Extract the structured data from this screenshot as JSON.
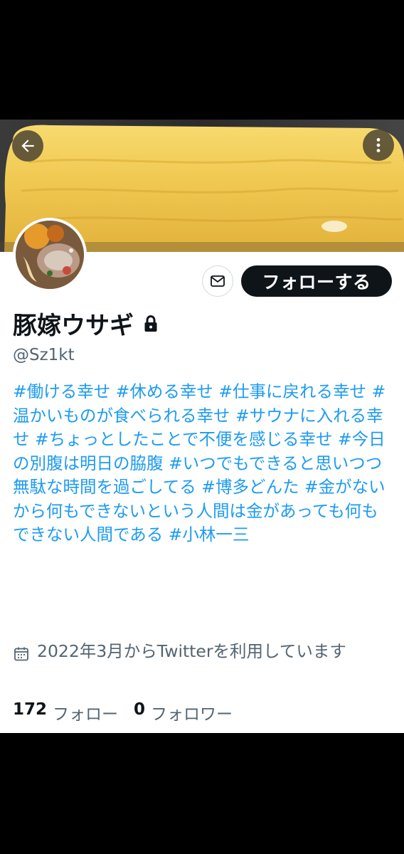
{
  "colors": {
    "accent": "#1d9bf0",
    "text_primary": "#0f1419",
    "text_secondary": "#536471",
    "follow_button_bg": "#0f1419",
    "banner_food": "#f2cc55"
  },
  "header": {
    "back_icon": "arrow-left-icon",
    "more_icon": "more-vertical-icon"
  },
  "actions": {
    "message_icon": "envelope-icon",
    "follow_label": "フォローする"
  },
  "profile": {
    "display_name": "豚嫁ウサギ",
    "protected_icon": "lock-icon",
    "handle": "@Sz1kt",
    "bio": "#働ける幸せ #休める幸せ #仕事に戻れる幸せ #温かいものが食べられる幸せ #サウナに入れる幸せ #ちょっとしたことで不便を感じる幸せ #今日の別腹は明日の脇腹 #いつでもできると思いつつ無駄な時間を過ごしてる #博多どんた #金がないから何もできないという人間は金があっても何もできない人間である #小林一三",
    "joined_icon": "calendar-icon",
    "joined": "2022年3月からTwitterを利用しています"
  },
  "stats": {
    "following_count": "172",
    "following_label": "フォロー",
    "followers_count": "0",
    "followers_label": "フォロワー"
  }
}
